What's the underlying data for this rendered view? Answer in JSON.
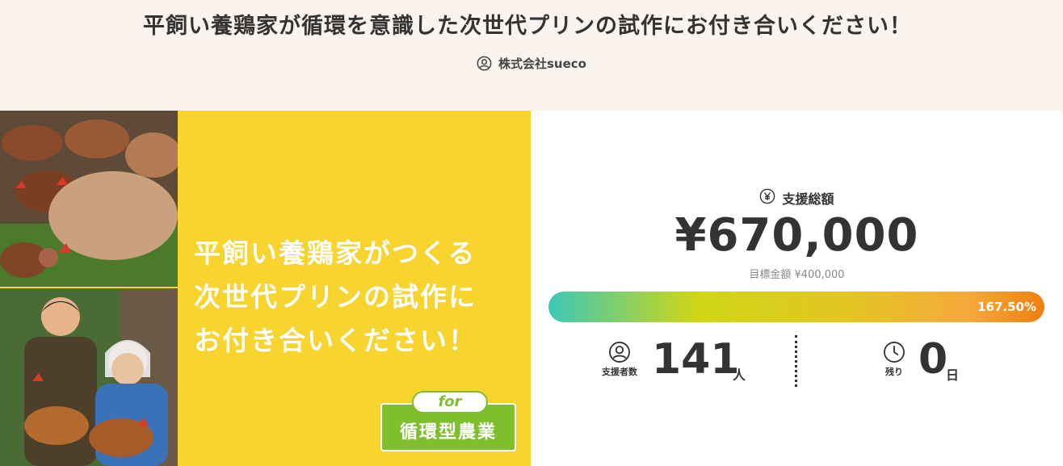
{
  "project": {
    "title": "平飼い養鶏家が循環を意識した次世代プリンの試作にお付き合いください！",
    "owner": "株式会社sueco"
  },
  "visual": {
    "headline_lines": [
      "平飼い養鶏家がつくる",
      "次世代プリンの試作に",
      "お付き合いください！"
    ],
    "badge_for": "for",
    "badge_label": "循環型農業"
  },
  "funding": {
    "total_label": "支援総額",
    "total_amount": "¥670,000",
    "target_label": "目標金額 ¥400,000",
    "progress_text": "167.50%",
    "progress_fill_fraction": 1.0
  },
  "backers": {
    "caption": "支援者数",
    "value": "141",
    "unit": "人"
  },
  "remaining": {
    "caption": "残り",
    "value": "0",
    "unit": "日"
  },
  "icons": {
    "owner": "user-circle-icon",
    "total": "yen-circle-icon",
    "backers": "user-circle-icon",
    "remaining": "clock-icon"
  },
  "colors": {
    "header_bg": "#fbf3ee",
    "visual_bg": "#f8d42f",
    "badge_green": "#7fbf2e",
    "progress_start": "#3cc9b6",
    "progress_end": "#ee7f10"
  }
}
